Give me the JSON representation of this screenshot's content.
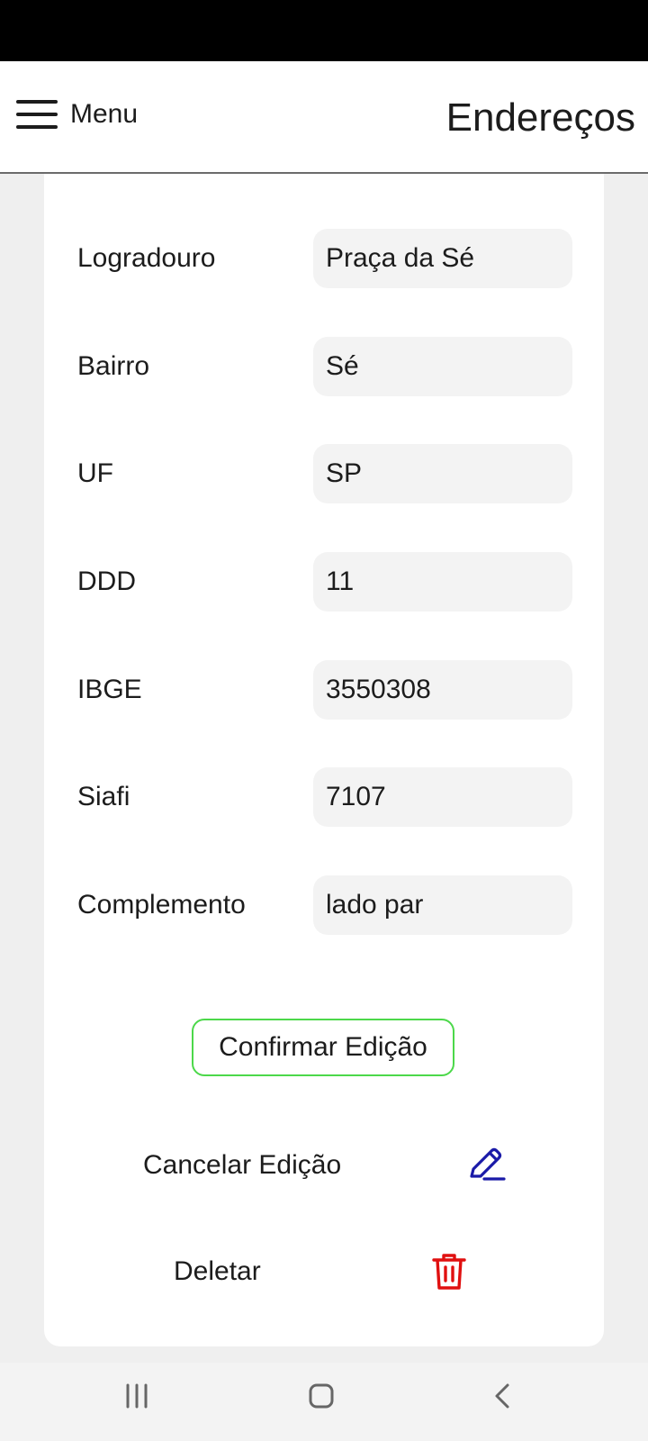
{
  "header": {
    "menu_label": "Menu",
    "title": "Endereços"
  },
  "form": {
    "fields": [
      {
        "label": "Logradouro",
        "value": "Praça da Sé"
      },
      {
        "label": "Bairro",
        "value": "Sé"
      },
      {
        "label": "UF",
        "value": "SP"
      },
      {
        "label": "DDD",
        "value": "11"
      },
      {
        "label": "IBGE",
        "value": "3550308"
      },
      {
        "label": "Siafi",
        "value": "7107"
      },
      {
        "label": "Complemento",
        "value": "lado par"
      }
    ],
    "confirm_label": "Confirmar Edição",
    "cancel_label": "Cancelar Edição",
    "delete_label": "Deletar"
  },
  "icons": {
    "menu": "hamburger-menu-icon",
    "edit": "pencil-icon",
    "delete": "trash-icon",
    "nav_recent": "recent-apps-icon",
    "nav_home": "home-icon",
    "nav_back": "back-chevron-icon"
  },
  "colors": {
    "confirm_border": "#4cd84a",
    "edit_icon": "#1a1aa8",
    "delete_icon": "#e01010",
    "input_bg": "#f3f3f3",
    "page_bg": "#efefef"
  }
}
